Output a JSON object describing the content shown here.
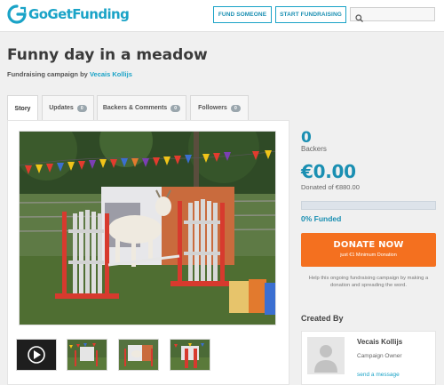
{
  "header": {
    "logo_text": "GoGetFunding",
    "fund_someone": "FUND SOMEONE",
    "start_fundraising": "START FUNDRAISING",
    "search_placeholder": ""
  },
  "campaign": {
    "title": "Funny day in a meadow",
    "subtitle_prefix": "Fundraising campaign by",
    "owner": "Vecais Kollijs"
  },
  "tabs": [
    {
      "label": "Story",
      "count": ""
    },
    {
      "label": "Updates",
      "count": "0"
    },
    {
      "label": "Backers & Comments",
      "count": "0"
    },
    {
      "label": "Followers",
      "count": "0"
    }
  ],
  "stats": {
    "backers_count": "0",
    "backers_label": "Backers",
    "raised": "€0.00",
    "donated_of": "Donated of €880.00",
    "progress_fraction": 0,
    "funded": "0% Funded"
  },
  "donate": {
    "label": "DONATE NOW",
    "minimum": "just €1 Minimum Donation"
  },
  "help_text": "Help this ongoing fundraising campaign by making a donation and spreading the word.",
  "created_by": {
    "heading": "Created By",
    "name": "Vecais Kollijs",
    "role": "Campaign Owner",
    "message_link": "send a message"
  },
  "colors": {
    "brand": "#1aa3c7",
    "donate": "#f4701f"
  }
}
